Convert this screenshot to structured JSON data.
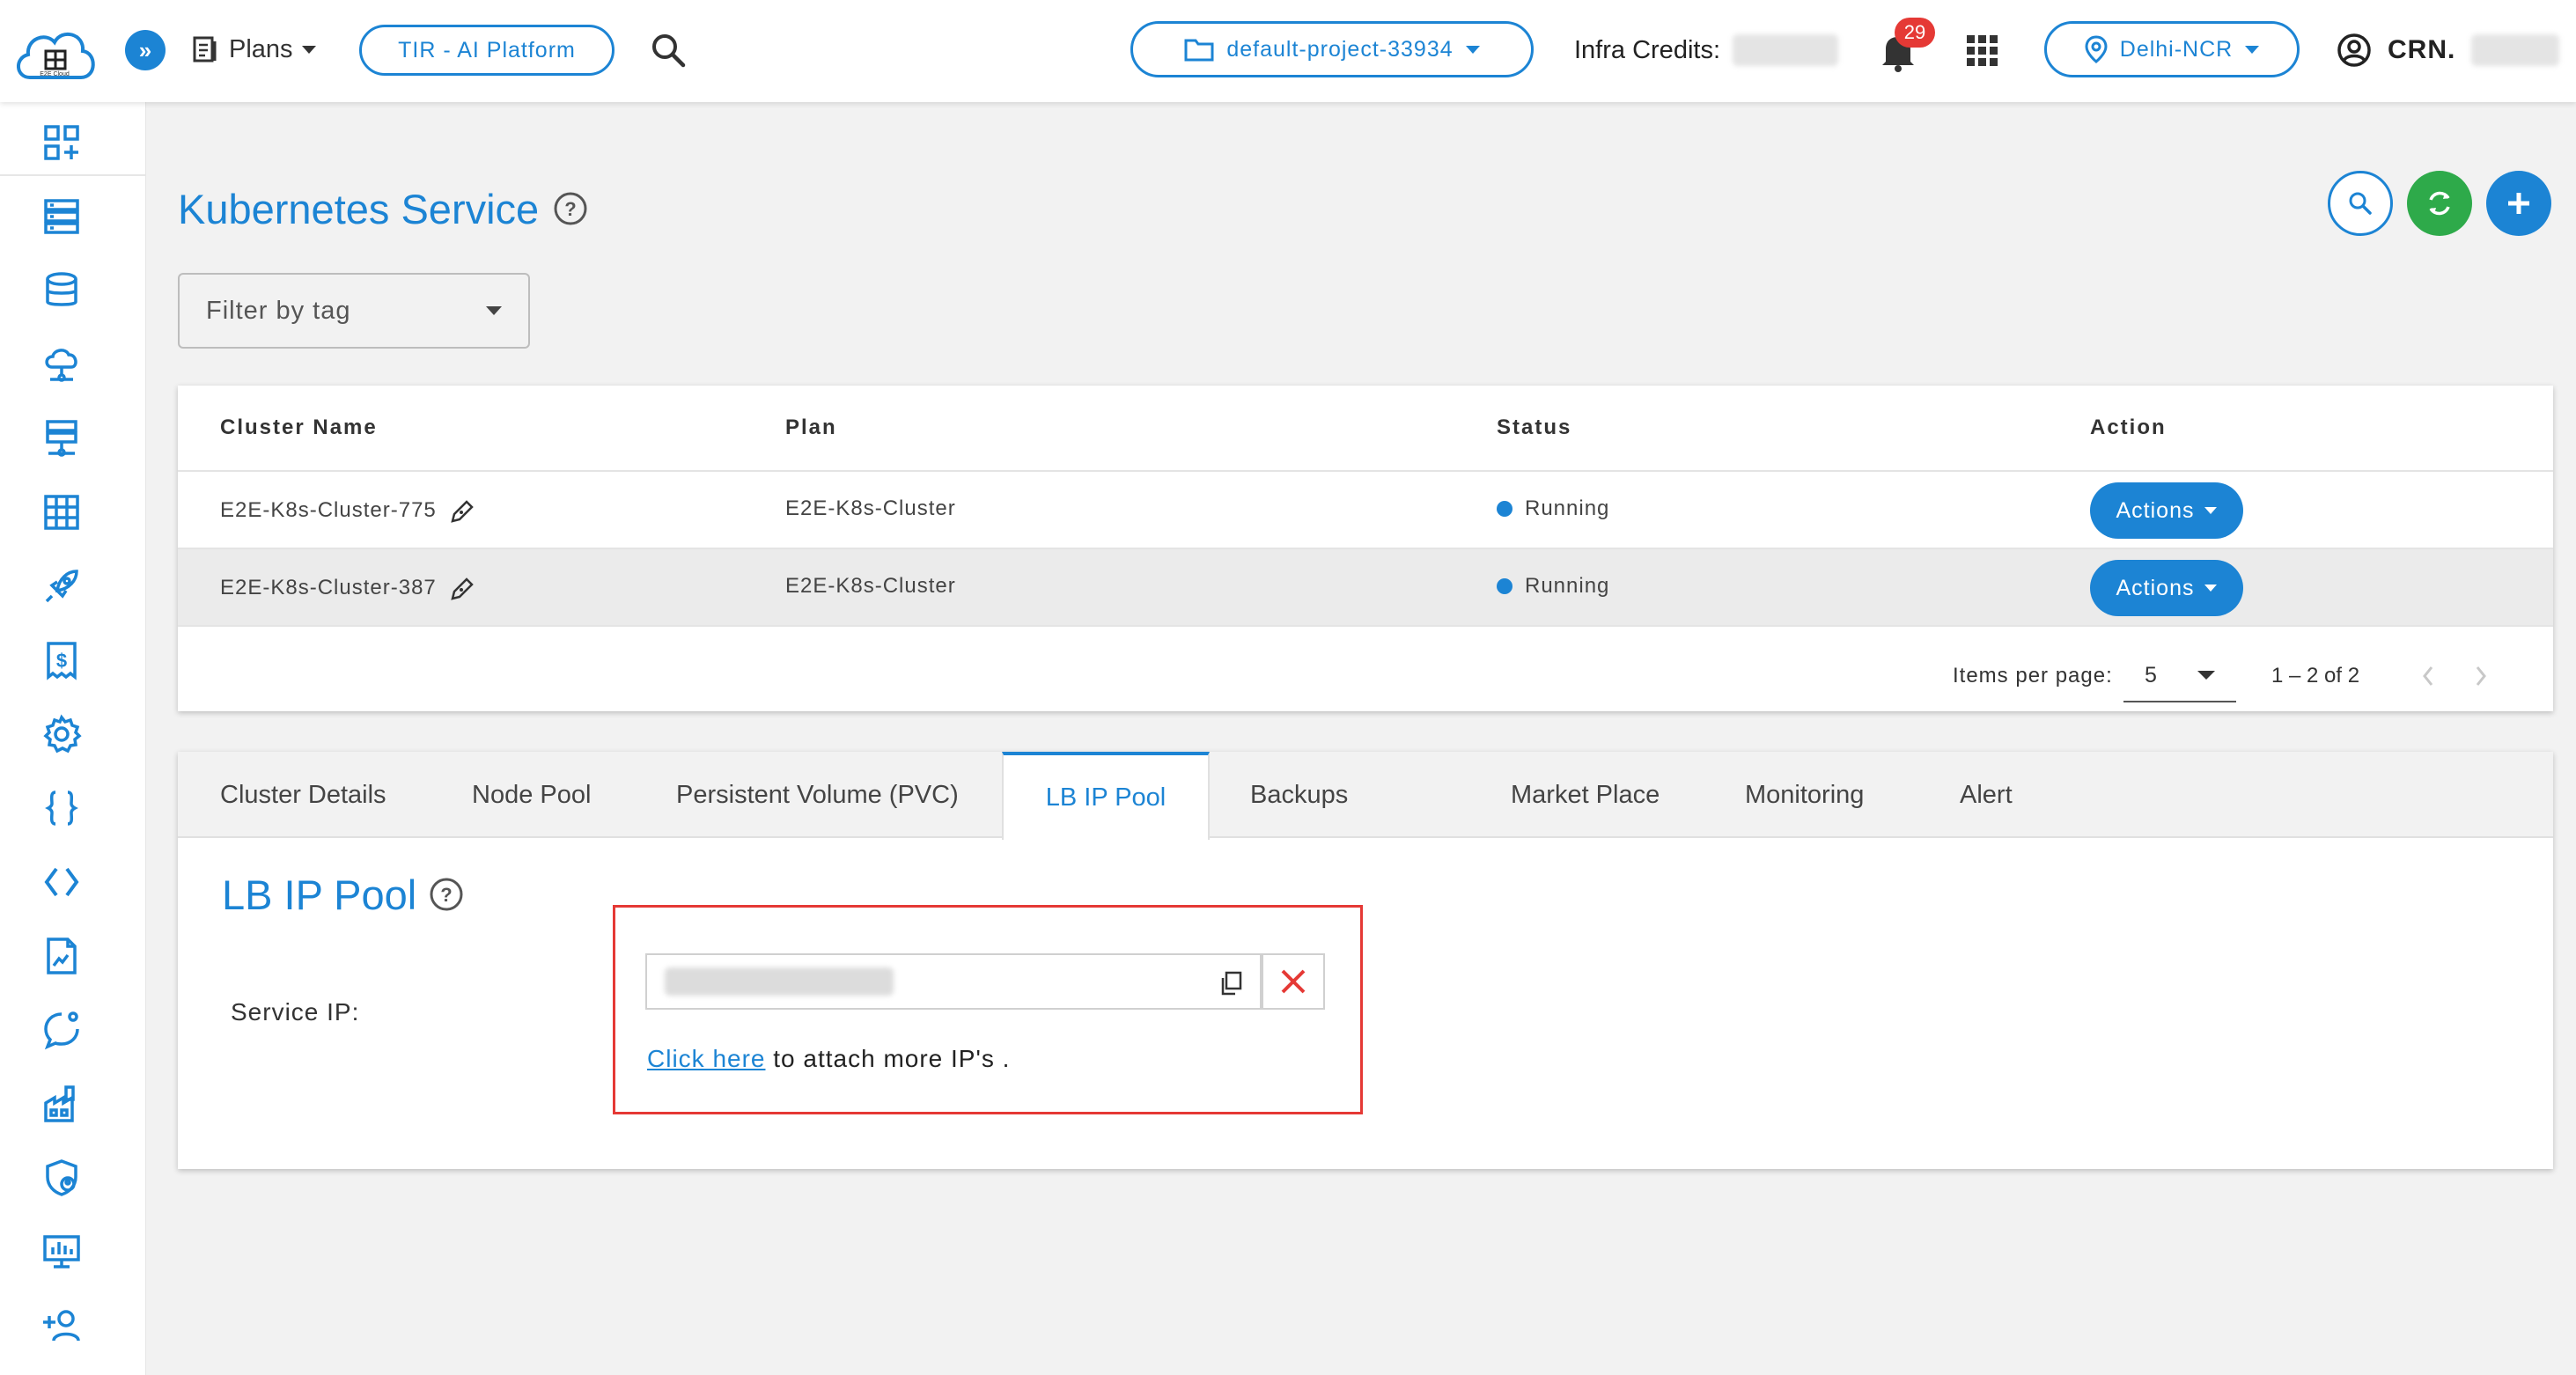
{
  "header": {
    "logo_text": "E2E Cloud",
    "plans_label": "Plans",
    "tir_label": "TIR - AI Platform",
    "project_label": "default-project-33934",
    "credits_label": "Infra Credits:",
    "notification_count": "29",
    "region_label": "Delhi-NCR",
    "crn_label": "CRN."
  },
  "sidebar": {
    "icons": [
      "dashboard-add-icon",
      "servers-icon",
      "database-icon",
      "cloud-network-icon",
      "network-storage-icon",
      "table-grid-icon",
      "rocket-icon",
      "billing-icon",
      "settings-gear-icon",
      "curly-braces-icon",
      "code-brackets-icon",
      "document-icon",
      "chat-help-icon",
      "factory-icon",
      "shield-user-icon",
      "monitor-chart-icon",
      "add-user-icon"
    ]
  },
  "page": {
    "title": "Kubernetes Service",
    "filter_placeholder": "Filter by tag"
  },
  "table": {
    "headers": [
      "Cluster Name",
      "Plan",
      "Status",
      "Action"
    ],
    "rows": [
      {
        "name": "E2E-K8s-Cluster-775",
        "plan": "E2E-K8s-Cluster",
        "status": "Running",
        "action": "Actions"
      },
      {
        "name": "E2E-K8s-Cluster-387",
        "plan": "E2E-K8s-Cluster",
        "status": "Running",
        "action": "Actions"
      }
    ],
    "paginator": {
      "items_per_page_label": "Items per page:",
      "page_size": "5",
      "range": "1 – 2 of 2"
    }
  },
  "tabs": {
    "items": [
      "Cluster Details",
      "Node Pool",
      "Persistent Volume (PVC)",
      "LB IP Pool",
      "Backups",
      "Market Place",
      "Monitoring",
      "Alert"
    ],
    "active": "LB IP Pool"
  },
  "lb_pool": {
    "title": "LB IP Pool",
    "service_ip_label": "Service IP:",
    "link_text": "Click here",
    "link_suffix": " to attach more IP's ."
  },
  "colors": {
    "accent": "#1c84d4",
    "refresh_green": "#2eaa4a",
    "highlight_red": "#e53935"
  }
}
